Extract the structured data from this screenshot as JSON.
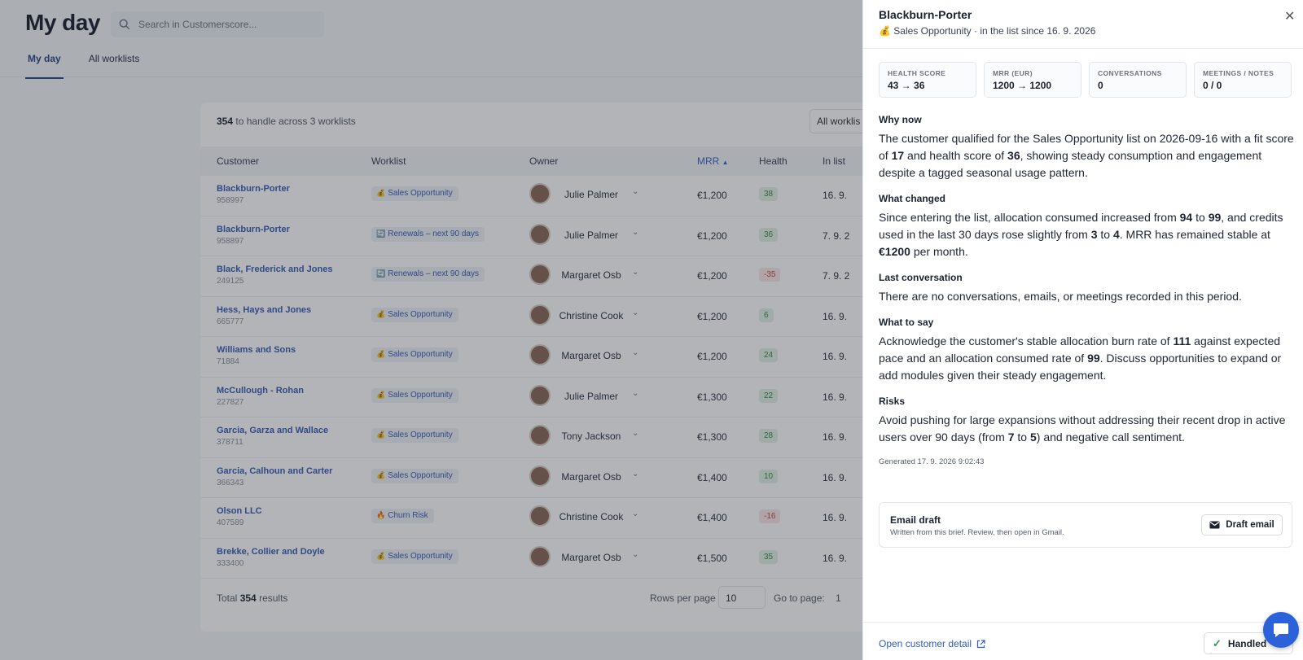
{
  "app": {
    "page_title": "My day",
    "search_placeholder": "Search in Customerscore...",
    "tabs": [
      {
        "label": "My day",
        "active": true
      },
      {
        "label": "All worklists",
        "active": false
      }
    ],
    "summary_count": "354",
    "summary_text": "to handle across 3 worklists",
    "filter_label": "All worklis",
    "columns": [
      "Customer",
      "Worklist",
      "Owner",
      "MRR",
      "Health",
      "In list"
    ],
    "rows": [
      {
        "customer": "Blackburn-Porter",
        "id": "958997",
        "worklist_icon": "💰",
        "worklist": "Sales Opportunity",
        "owner": "Julie Palmer",
        "mrr": "€1,200",
        "health": "38",
        "health_neg": false,
        "in_list": "16. 9."
      },
      {
        "customer": "Blackburn-Porter",
        "id": "958897",
        "worklist_icon": "🔄",
        "worklist": "Renewals – next 90 days",
        "owner": "Julie Palmer",
        "mrr": "€1,200",
        "health": "36",
        "health_neg": false,
        "in_list": "7. 9. 2"
      },
      {
        "customer": "Black, Frederick and Jones",
        "id": "249125",
        "worklist_icon": "🔄",
        "worklist": "Renewals – next 90 days",
        "owner": "Margaret Osb",
        "mrr": "€1,200",
        "health": "-35",
        "health_neg": true,
        "in_list": "7. 9. 2"
      },
      {
        "customer": "Hess, Hays and Jones",
        "id": "665777",
        "worklist_icon": "💰",
        "worklist": "Sales Opportunity",
        "owner": "Christine Cook",
        "mrr": "€1,200",
        "health": "6",
        "health_neg": false,
        "in_list": "16. 9."
      },
      {
        "customer": "Williams and Sons",
        "id": "71884",
        "worklist_icon": "💰",
        "worklist": "Sales Opportunity",
        "owner": "Margaret Osb",
        "mrr": "€1,200",
        "health": "24",
        "health_neg": false,
        "in_list": "16. 9."
      },
      {
        "customer": "McCullough - Rohan",
        "id": "227827",
        "worklist_icon": "💰",
        "worklist": "Sales Opportunity",
        "owner": "Julie Palmer",
        "mrr": "€1,300",
        "health": "22",
        "health_neg": false,
        "in_list": "16. 9."
      },
      {
        "customer": "Garcia, Garza and Wallace",
        "id": "378711",
        "worklist_icon": "💰",
        "worklist": "Sales Opportunity",
        "owner": "Tony Jackson",
        "mrr": "€1,300",
        "health": "28",
        "health_neg": false,
        "in_list": "16. 9."
      },
      {
        "customer": "Garcia, Calhoun and Carter",
        "id": "366343",
        "worklist_icon": "💰",
        "worklist": "Sales Opportunity",
        "owner": "Margaret Osb",
        "mrr": "€1,400",
        "health": "10",
        "health_neg": false,
        "in_list": "16. 9."
      },
      {
        "customer": "Olson LLC",
        "id": "407589",
        "worklist_icon": "🔥",
        "worklist": "Churn Risk",
        "owner": "Christine Cook",
        "mrr": "€1,400",
        "health": "-16",
        "health_neg": true,
        "in_list": "16. 9."
      },
      {
        "customer": "Brekke, Collier and Doyle",
        "id": "333400",
        "worklist_icon": "💰",
        "worklist": "Sales Opportunity",
        "owner": "Margaret Osb",
        "mrr": "€1,500",
        "health": "35",
        "health_neg": false,
        "in_list": "16. 9."
      }
    ],
    "total_label": "Total",
    "total_count": "354",
    "total_suffix": "results",
    "rows_per_page_label": "Rows per page",
    "rows_per_page_value": "10",
    "goto_label": "Go to page:",
    "goto_value": "1"
  },
  "drawer": {
    "title": "Blackburn-Porter",
    "subtitle_icon": "💰",
    "subtitle": "Sales Opportunity · in the list since 16. 9. 2026",
    "metrics": [
      {
        "label": "HEALTH SCORE",
        "value": "43 → 36"
      },
      {
        "label": "MRR (EUR)",
        "value": "1200 → 1200"
      },
      {
        "label": "CONVERSATIONS",
        "value": "0"
      },
      {
        "label": "MEETINGS / NOTES",
        "value": "0 / 0"
      }
    ],
    "why_now_heading": "Why now",
    "why_now": {
      "t1": "The customer qualified for the Sales Opportunity list on 2026-09-16 with a fit score of ",
      "b1": "17",
      "t2": " and health score of ",
      "b2": "36",
      "t3": ", showing steady consumption and engagement despite a tagged seasonal usage pattern."
    },
    "what_changed_heading": "What changed",
    "what_changed": {
      "t1": "Since entering the list, allocation consumed increased from ",
      "b1": "94",
      "t2": " to ",
      "b2": "99",
      "t3": ", and credits used in the last 30 days rose slightly from ",
      "b3": "3",
      "t4": " to ",
      "b4": "4",
      "t5": ". MRR has remained stable at ",
      "b5": "€1200",
      "t6": " per month."
    },
    "last_conv_heading": "Last conversation",
    "last_conv": "There are no conversations, emails, or meetings recorded in this period.",
    "what_to_say_heading": "What to say",
    "what_to_say": {
      "t1": "Acknowledge the customer's stable allocation burn rate of ",
      "b1": "111",
      "t2": " against expected pace and an allocation consumed rate of ",
      "b2": "99",
      "t3": ". Discuss opportunities to expand or add modules given their steady engagement."
    },
    "risks_heading": "Risks",
    "risks": {
      "t1": "Avoid pushing for large expansions without addressing their recent drop in active users over 90 days (from ",
      "b1": "7",
      "t2": " to ",
      "b2": "5",
      "t3": ") and negative call sentiment."
    },
    "generated": "Generated 17. 9. 2026 9:02:43",
    "email_title": "Email draft",
    "email_sub": "Written from this brief. Review, then open in Gmail.",
    "draft_button": "Draft email",
    "open_detail": "Open customer detail",
    "handled_button": "Handled"
  }
}
